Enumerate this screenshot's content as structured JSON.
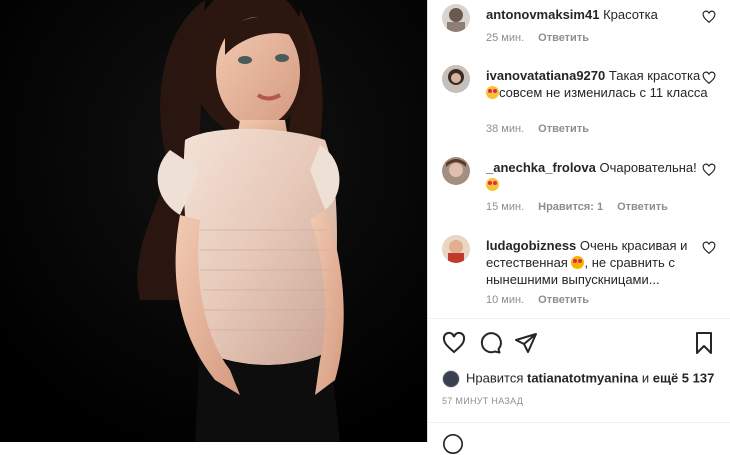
{
  "comments": [
    {
      "user": "antonovmaksim41",
      "text": "Красотка",
      "time": "25 мин.",
      "likes": "",
      "reply": "Ответить"
    },
    {
      "user": "ivanovatatiana9270",
      "text": "Такая красотка",
      "text2": "совсем не изменилась с 11 класса",
      "time": "38 мин.",
      "likes": "",
      "reply": "Ответить"
    },
    {
      "user": "_anechka_frolova",
      "text": "Очаровательна!",
      "time": "15 мин.",
      "likes": "Нравится: 1",
      "reply": "Ответить"
    },
    {
      "user": "ludagobizness",
      "text": "Очень красивая и естественная",
      "text2": ", не сравнить с нынешними выпускницами...",
      "time": "10 мин.",
      "likes": "",
      "reply": "Ответить"
    }
  ],
  "likes_line": {
    "prefix": "Нравится",
    "user": "tatianatotmyanina",
    "and": "и",
    "more": "ещё 5 137"
  },
  "posted_ago": "57 МИНУТ НАЗАД",
  "icons": [
    "heart-icon",
    "comment-icon",
    "share-icon",
    "bookmark-icon"
  ]
}
